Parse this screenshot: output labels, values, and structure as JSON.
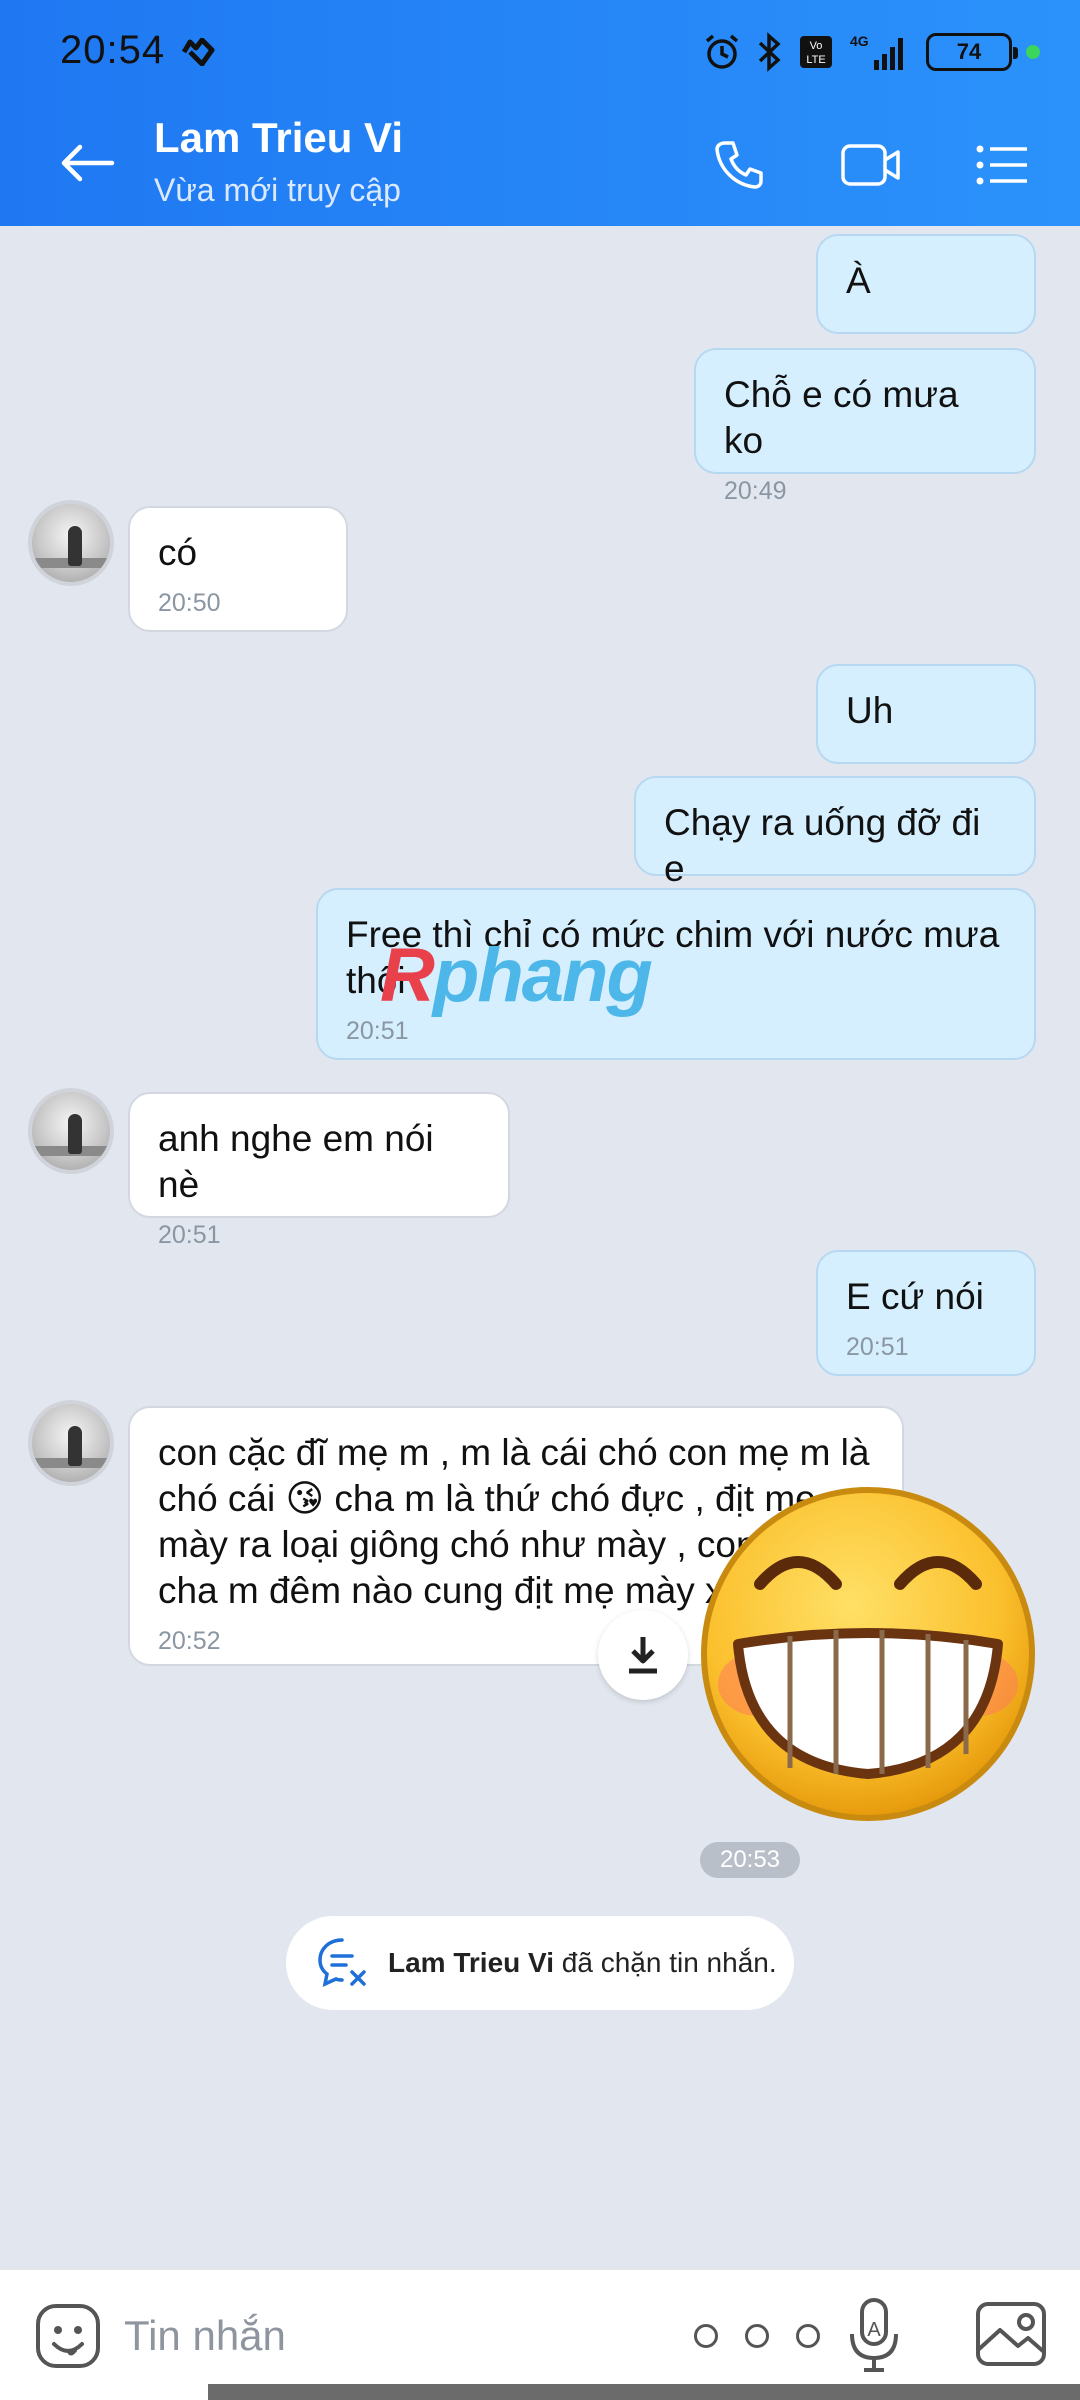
{
  "status_bar": {
    "time": "20:54",
    "network": "4G",
    "volte": "Vo LTE",
    "battery": "74"
  },
  "header": {
    "contact_name": "Lam Trieu Vi",
    "contact_status": "Vừa mới truy cập",
    "icons": [
      "back-arrow-icon",
      "phone-icon",
      "video-call-icon",
      "menu-list-icon"
    ],
    "colors": {
      "gradient_start": "#1f78f2",
      "gradient_end": "#2b92fb"
    }
  },
  "messages": [
    {
      "dir": "out",
      "text": "À",
      "time": ""
    },
    {
      "dir": "out",
      "text": "Chỗ e có mưa ko",
      "time": "20:49"
    },
    {
      "dir": "in",
      "text": "có",
      "time": "20:50"
    },
    {
      "dir": "out",
      "text": "Uh",
      "time": ""
    },
    {
      "dir": "out",
      "text": "Chạy ra uống đỡ đi e",
      "time": ""
    },
    {
      "dir": "out",
      "text": "Free thì chỉ có mức chim với nước mưa thôi",
      "time": "20:51"
    },
    {
      "dir": "in",
      "text": "anh nghe em nói nè",
      "time": "20:51"
    },
    {
      "dir": "out",
      "text": "E cứ nói",
      "time": "20:51"
    },
    {
      "dir": "in",
      "text": "con cặc đĩ mẹ m , m là cái chó con mẹ m là chó cái 😘 cha m là thứ chó đực , địt mẹ mày ra loại giông chó như mày , con cặc cha m đêm nào cung địt mẹ mày xưng lồn",
      "time": "20:52"
    }
  ],
  "sticker": {
    "name": "grinning-face-sticker",
    "time": "20:53"
  },
  "watermark": {
    "r": "R",
    "rest": "phang"
  },
  "notice": {
    "name": "Lam Trieu Vi",
    "text": "đã chặn tin nhắn."
  },
  "input_bar": {
    "placeholder": "Tin nhắn"
  }
}
